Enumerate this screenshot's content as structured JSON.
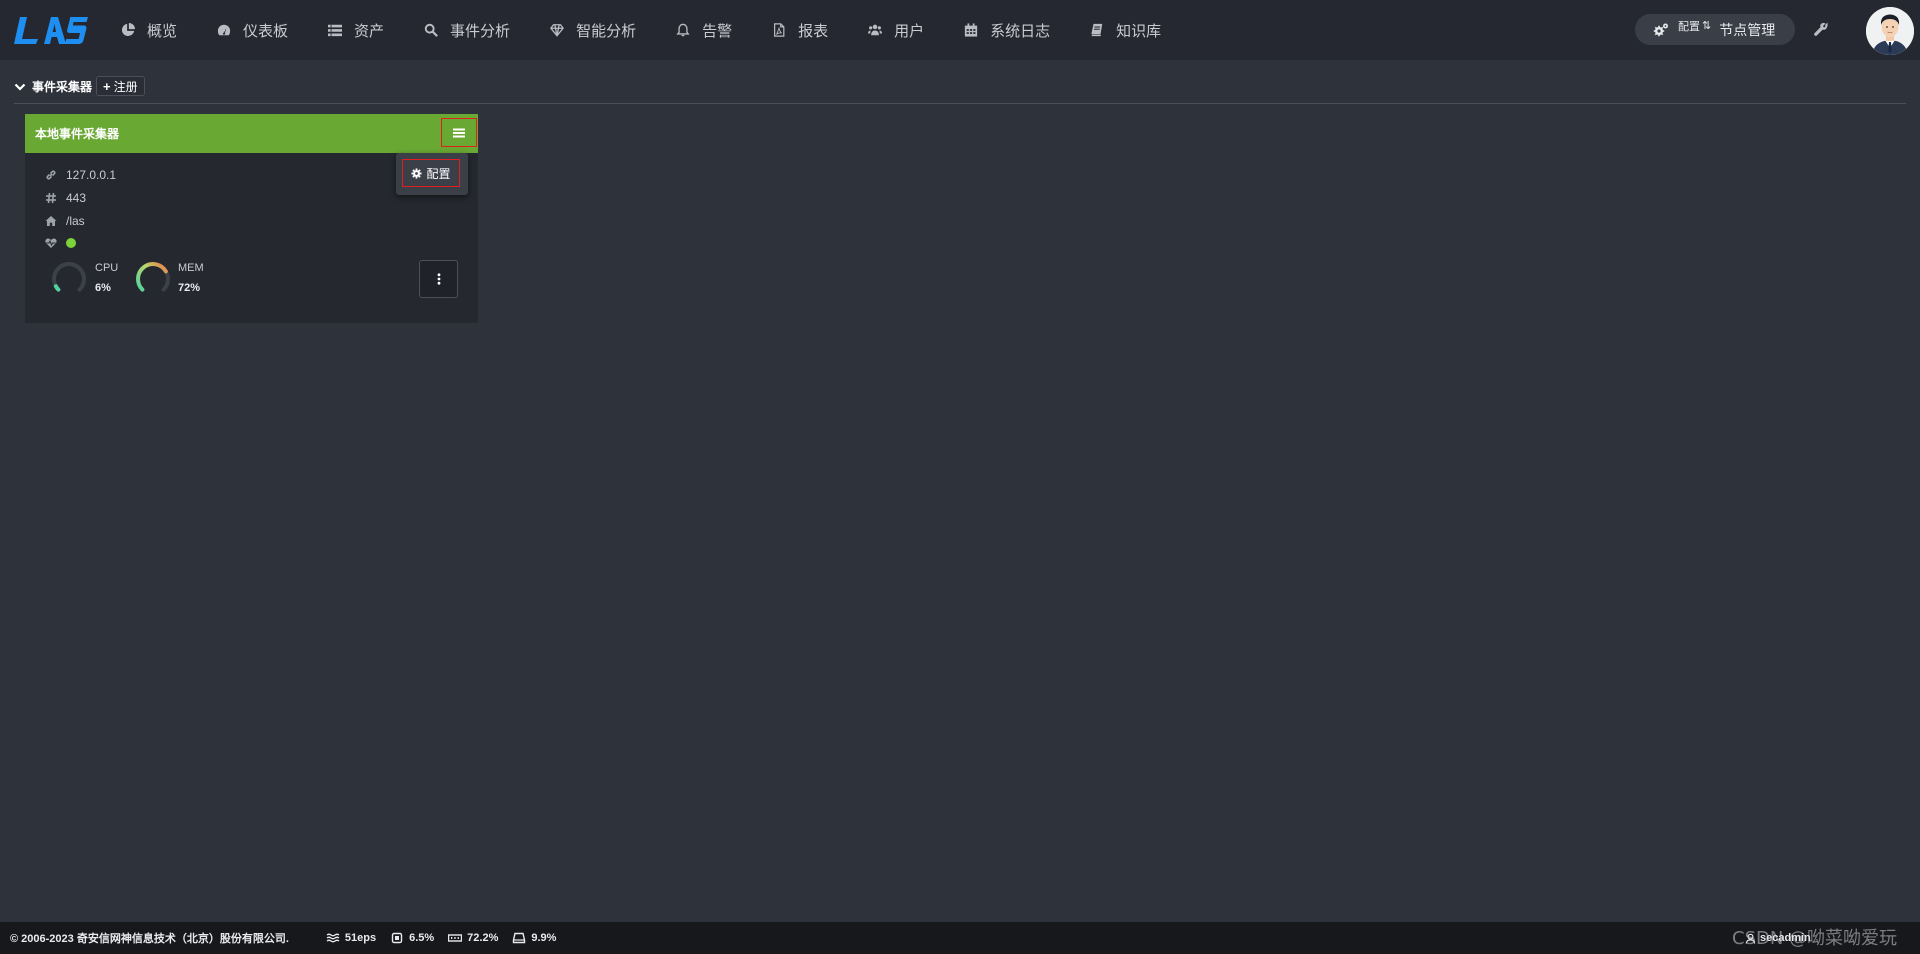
{
  "app": {
    "logo_text": "LAS"
  },
  "nav": {
    "items": [
      {
        "label": "概览",
        "icon": "pie-chart-icon"
      },
      {
        "label": "仪表板",
        "icon": "dashboard-icon"
      },
      {
        "label": "资产",
        "icon": "list-icon"
      },
      {
        "label": "事件分析",
        "icon": "search-icon"
      },
      {
        "label": "智能分析",
        "icon": "diamond-icon"
      },
      {
        "label": "告警",
        "icon": "bell-icon"
      },
      {
        "label": "报表",
        "icon": "pdf-file-icon"
      },
      {
        "label": "用户",
        "icon": "users-icon"
      },
      {
        "label": "系统日志",
        "icon": "calendar-icon"
      },
      {
        "label": "知识库",
        "icon": "book-icon"
      }
    ],
    "node_button": {
      "badge": "配置",
      "label": "节点管理"
    }
  },
  "section": {
    "title": "事件采集器",
    "register_label": "注册"
  },
  "collector": {
    "name": "本地事件采集器",
    "ip": "127.0.0.1",
    "port": "443",
    "path": "/las",
    "status": "online",
    "cpu": {
      "label": "CPU",
      "value": "6%",
      "fraction": 0.06
    },
    "mem": {
      "label": "MEM",
      "value": "72%",
      "fraction": 0.72
    },
    "menu": {
      "configure_label": "配置"
    }
  },
  "footer": {
    "copyright": "© 2006-2023 奇安信网神信息技术（北京）股份有限公司.",
    "eps": "51eps",
    "cpu": "6.5%",
    "mem": "72.2%",
    "disk": "9.9%",
    "user": "secadmin"
  },
  "watermark": "CSDN @呦菜呦爱玩",
  "colors": {
    "background": "#2e323b",
    "topbar": "#252830",
    "card_header": "#6aa834",
    "status_online": "#7dd23b",
    "highlight_border": "#e02020",
    "logo": "#1e8ff0"
  }
}
